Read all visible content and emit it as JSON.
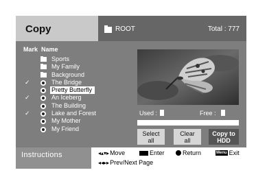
{
  "header": {
    "title": "Copy",
    "folder_icon": "folder-icon",
    "path": "ROOT",
    "total": "Total : 777"
  },
  "columns": {
    "mark": "Mark",
    "name": "Name"
  },
  "items": [
    {
      "name": "Sports",
      "type": "folder",
      "marked": false,
      "selected": false
    },
    {
      "name": "My Family",
      "type": "folder",
      "marked": false,
      "selected": false
    },
    {
      "name": "Background",
      "type": "folder",
      "marked": false,
      "selected": false
    },
    {
      "name": "The Bridge",
      "type": "photo",
      "marked": true,
      "selected": false
    },
    {
      "name": "Pretty Butterfly",
      "type": "photo",
      "marked": false,
      "selected": true
    },
    {
      "name": "An Iceberg",
      "type": "photo",
      "marked": true,
      "selected": false
    },
    {
      "name": "The Building",
      "type": "photo",
      "marked": false,
      "selected": false
    },
    {
      "name": "Lake and Forest",
      "type": "photo",
      "marked": true,
      "selected": false
    },
    {
      "name": "My Mother",
      "type": "photo",
      "marked": false,
      "selected": false
    },
    {
      "name": "My Friend",
      "type": "photo",
      "marked": false,
      "selected": false
    }
  ],
  "check_mark": "✓",
  "storage": {
    "used_label": "Used :",
    "free_label": "Free :"
  },
  "buttons": {
    "select_all_line1": "Select",
    "select_all_line2": "all",
    "clear_all_line1": "Clear",
    "clear_all_line2": "all",
    "copy_line1": "Copy to",
    "copy_line2": "HDD"
  },
  "instructions": {
    "title": "Instructions",
    "move_glyph": "◂▴▾▸",
    "move": "Move",
    "enter": "Enter",
    "return": "Return",
    "menu_key": "Menu",
    "exit": "Exit",
    "page_glyph": "◂◂▸▸",
    "page": "Prev/Next Page"
  },
  "colors": {
    "background": "#7e7e7e",
    "title_bg": "#c9c9c9",
    "header_bar": "#666666",
    "button_bg": "#d6d6d6",
    "copy_button_bg": "#555555"
  }
}
